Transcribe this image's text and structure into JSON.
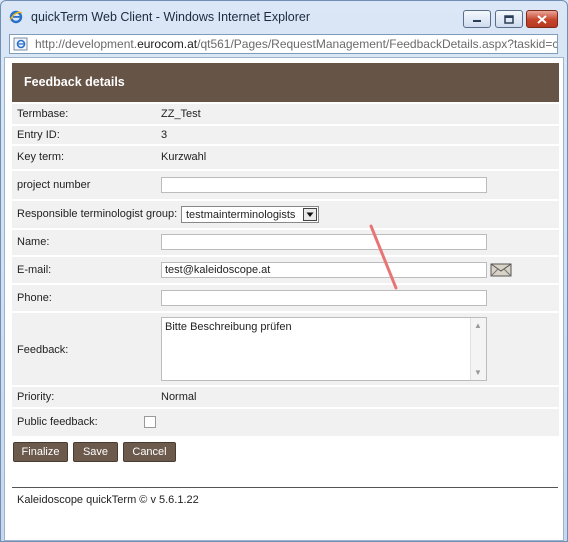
{
  "window": {
    "title": "quickTerm Web Client - Windows Internet Explorer",
    "icons": {
      "app": "ie-icon",
      "minimize": "minimize-icon",
      "maximize": "maximize-icon",
      "close": "close-icon"
    }
  },
  "address": {
    "prefix": "http://development.",
    "domain": "eurocom.at",
    "suffix": "/qt561/Pages/RequestManagement/FeedbackDetails.aspx?taskid=c"
  },
  "form": {
    "heading": "Feedback details",
    "termbase_label": "Termbase:",
    "termbase_value": "ZZ_Test",
    "entry_id_label": "Entry ID:",
    "entry_id_value": "3",
    "key_term_label": "Key term:",
    "key_term_value": "Kurzwahl",
    "project_number_label": "project number",
    "project_number_value": "",
    "group_label": "Responsible terminologist group:",
    "group_value": "testmainterminologists",
    "name_label": "Name:",
    "name_value": "",
    "email_label": "E-mail:",
    "email_value": "test@kaleidoscope.at",
    "phone_label": "Phone:",
    "phone_value": "",
    "feedback_label": "Feedback:",
    "feedback_value": "Bitte Beschreibung prüfen",
    "priority_label": "Priority:",
    "priority_value": "Normal",
    "public_feedback_label": "Public feedback:",
    "public_feedback_checked": false
  },
  "buttons": {
    "finalize": "Finalize",
    "save": "Save",
    "cancel": "Cancel"
  },
  "footer": {
    "text": "Kaleidoscope quickTerm © v 5.6.1.22"
  },
  "colors": {
    "header": "#665447",
    "button": "#6c5a4d",
    "annotation": "#e87474"
  }
}
